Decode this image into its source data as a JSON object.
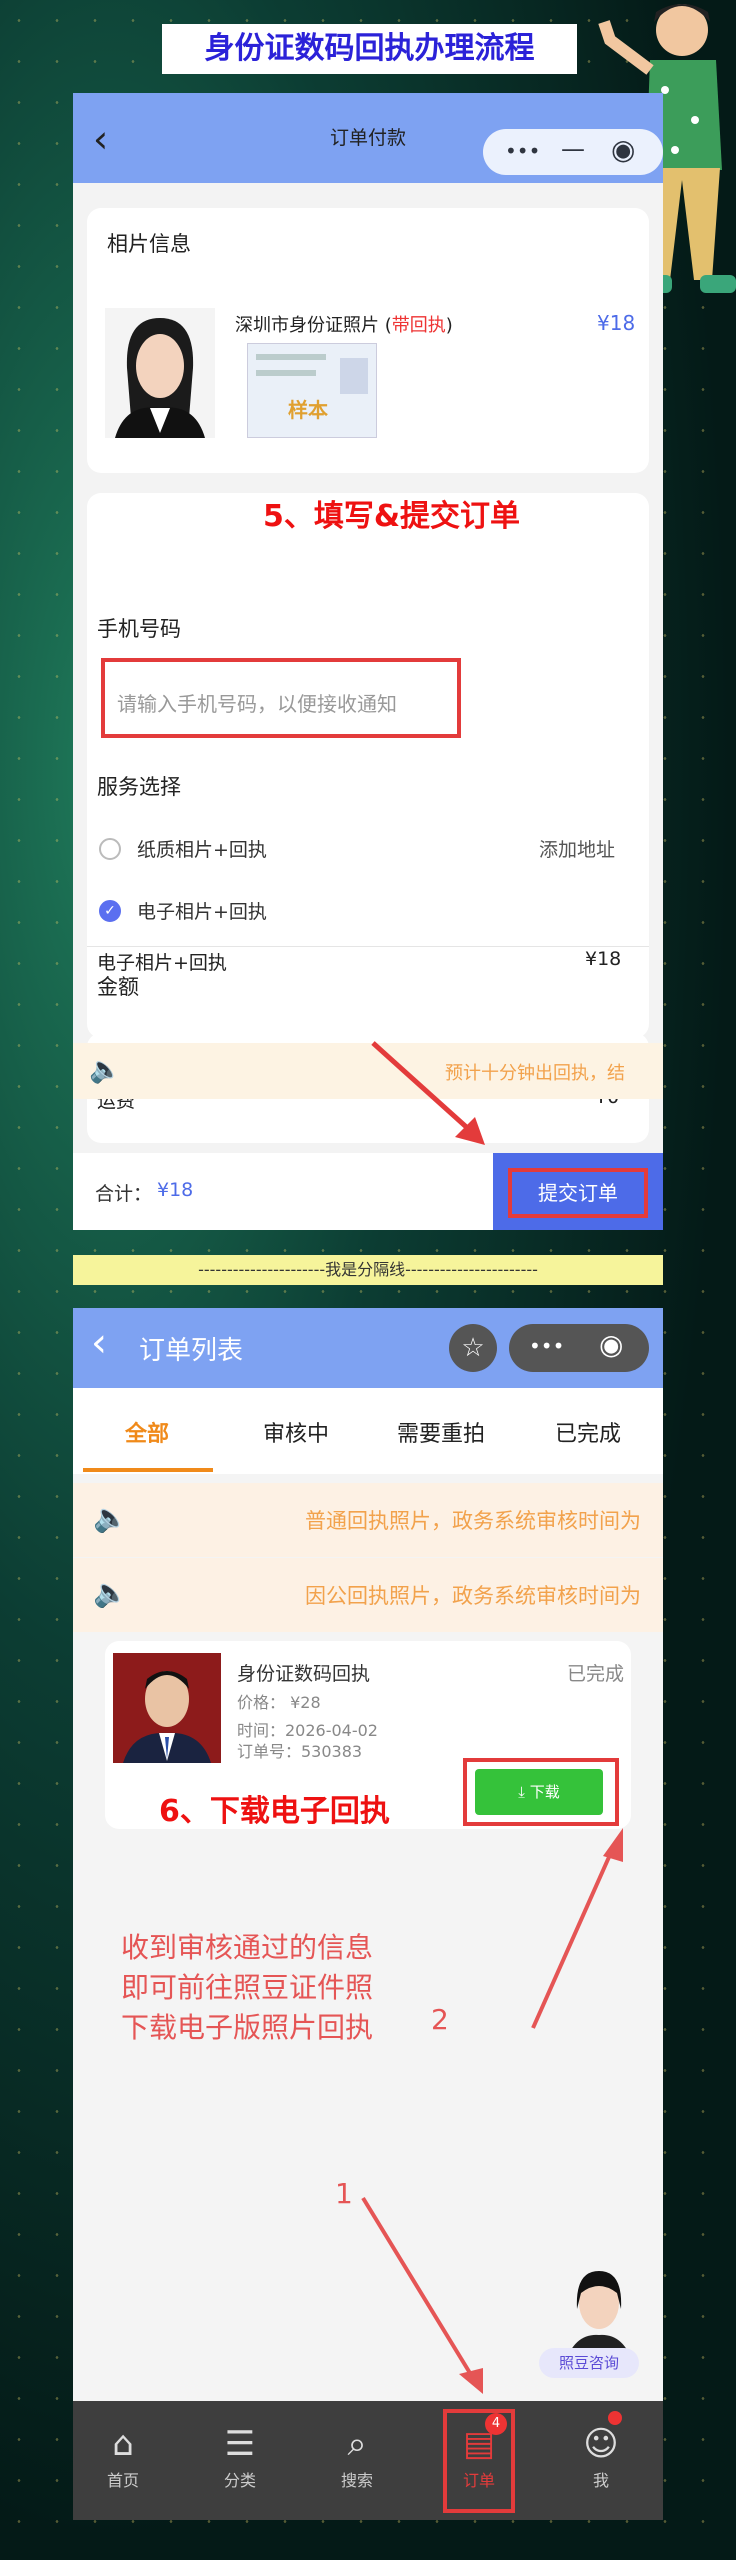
{
  "banner_title": "身份证数码回执办理流程",
  "order_pay": {
    "back_icon": "chevron-left-icon",
    "title": "订单付款",
    "photo_section_label": "相片信息",
    "product_name": "深圳市身份证照片 (",
    "product_tag": "带回执",
    "product_name_end": ")",
    "product_price": "¥18",
    "sample_stamp": "样本",
    "phone_label": "手机号码",
    "phone_placeholder": "请输入手机号码，以便接收通知",
    "step5": "5、填写&提交订单",
    "service_label": "服务选择",
    "service_opt1": "纸质相片+回执",
    "add_address": "添加地址",
    "service_opt2": "电子相片+回执",
    "amount_label": "金额",
    "amount_item": "电子相片+回执",
    "amount_item_price": "¥18",
    "shipping_label": "运费",
    "shipping_price": "¥0",
    "notice": "预计十分钟出回执，结",
    "total_label": "合计：",
    "total_value": "¥18",
    "submit": "提交订单"
  },
  "separator": "----------------------我是分隔线-----------------------",
  "order_list": {
    "title": "订单列表",
    "tabs": [
      "全部",
      "审核中",
      "需要重拍",
      "已完成"
    ],
    "notice1": "普通回执照片，政务系统审核时间为",
    "notice2": "因公回执照片，政务系统审核时间为",
    "order_name": "身份证数码回执",
    "order_status": "已完成",
    "order_price": "价格：  ¥28",
    "order_time": "时间：2026-04-02",
    "order_no": "订单号：530383",
    "download": "⤓ 下载",
    "step6": "6、下载电子回执",
    "instruction": [
      "收到审核通过的信息",
      "即可前往照豆证件照",
      "下载电子版照片回执"
    ],
    "num2": "2",
    "num1": "1",
    "consult": "照豆咨询",
    "tabbar": [
      "首页",
      "分类",
      "搜索",
      "订单",
      "我"
    ],
    "order_badge": "4"
  }
}
